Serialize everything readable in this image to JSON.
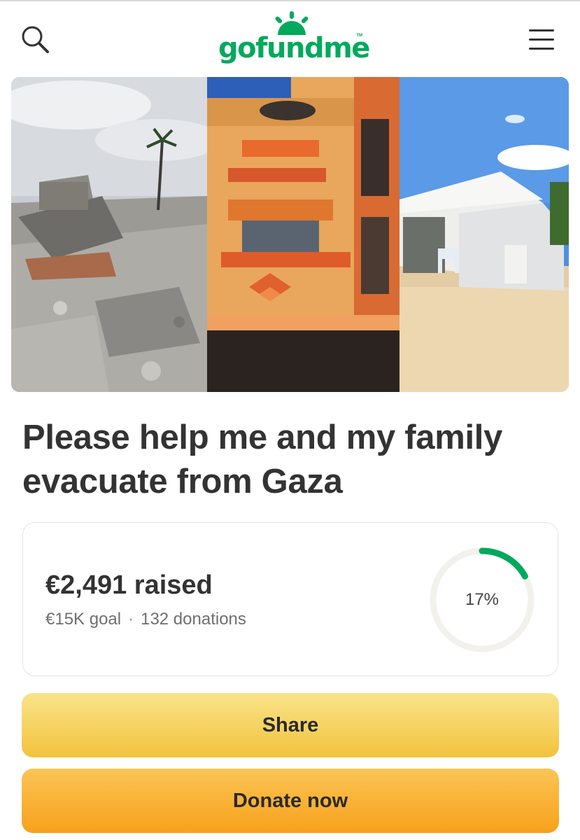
{
  "header": {
    "logo_text": "gofundme",
    "logo_tm": "TM",
    "search_icon": "search-icon",
    "menu_icon": "hamburger-menu-icon",
    "brand_color": "#02a95c"
  },
  "hero": {
    "panels": [
      "destroyed-buildings-rubble",
      "orange-apartment-building",
      "white-tent-on-sand"
    ]
  },
  "campaign": {
    "title": "Please help me and my family evacuate from Gaza"
  },
  "progress_card": {
    "raised_text": "€2,491 raised",
    "goal_text": "€15K goal",
    "separator": "·",
    "donations_text": "132 donations",
    "percent_label": "17%",
    "percent_value": 0.17,
    "ring_color": "#02a95c",
    "track_color": "#f2f1ec"
  },
  "actions": {
    "share_label": "Share",
    "donate_label": "Donate now",
    "share_color": "#f3c23d",
    "donate_color": "#f7a11a"
  }
}
